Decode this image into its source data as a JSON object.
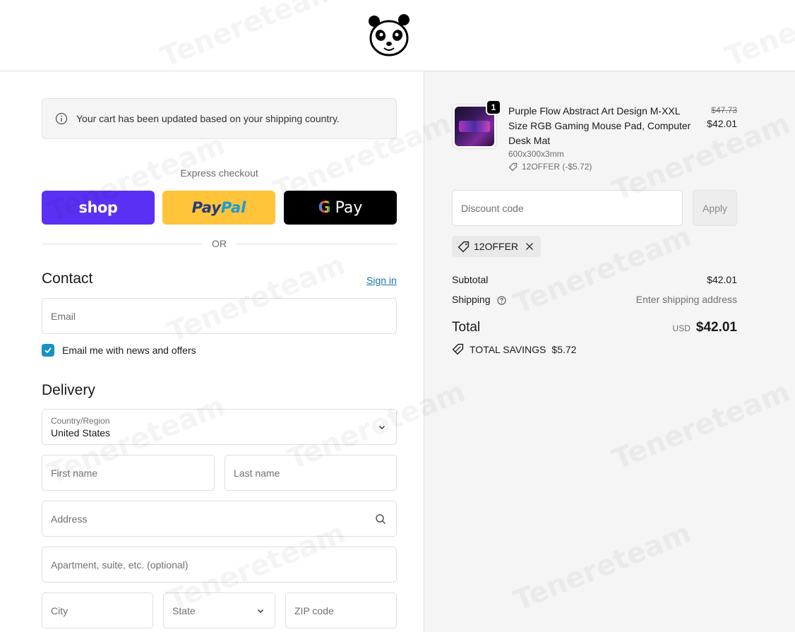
{
  "notice": {
    "text": "Your cart has been updated based on your shipping country."
  },
  "express": {
    "label": "Express checkout",
    "shop_label": "shop",
    "paypal_part1": "Pay",
    "paypal_part2": "Pal",
    "gpay_g": "G",
    "gpay_label": "Pay"
  },
  "divider": {
    "or": "OR"
  },
  "contact": {
    "title": "Contact",
    "sign_in": "Sign in",
    "email_placeholder": "Email",
    "newsletter_label": "Email me with news and offers",
    "newsletter_checked": true
  },
  "delivery": {
    "title": "Delivery",
    "country_label": "Country/Region",
    "country_value": "United States",
    "first_name": "First name",
    "last_name": "Last name",
    "address": "Address",
    "apartment": "Apartment, suite, etc. (optional)",
    "city": "City",
    "state": "State",
    "zip": "ZIP code"
  },
  "order": {
    "item": {
      "quantity": "1",
      "name": "Purple Flow Abstract Art Design M-XXL Size RGB Gaming Mouse Pad, Computer Desk Mat",
      "variant": "600x300x3mm",
      "discount": "12OFFER (-$5.72)",
      "original_price": "$47.73",
      "price": "$42.01"
    },
    "discount_placeholder": "Discount code",
    "apply_label": "Apply",
    "applied_code": "12OFFER",
    "subtotal_label": "Subtotal",
    "subtotal_value": "$42.01",
    "shipping_label": "Shipping",
    "shipping_value": "Enter shipping address",
    "total_label": "Total",
    "currency": "USD",
    "total_value": "$42.01",
    "savings_label": "TOTAL SAVINGS",
    "savings_value": "$5.72"
  },
  "watermark": "Tenereteam",
  "colors": {
    "shop": "#5a31f4",
    "paypal": "#ffc439",
    "gpay": "#000000",
    "link": "#1773b0",
    "checkbox": "#1990c6",
    "sidebar_bg": "#f5f5f5"
  }
}
